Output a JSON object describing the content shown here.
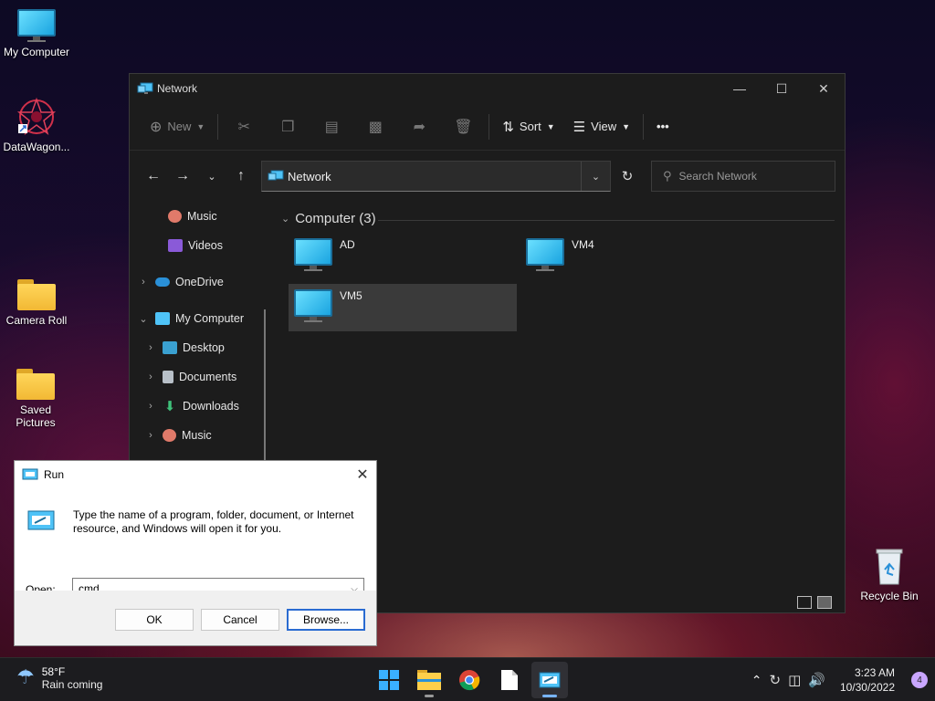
{
  "desktop": {
    "icons": [
      {
        "label": "My Computer"
      },
      {
        "label": "DataWagon..."
      },
      {
        "label": "Camera Roll"
      },
      {
        "label": "Saved Pictures"
      },
      {
        "label": "Recycle Bin"
      }
    ]
  },
  "explorer": {
    "title": "Network",
    "toolbar": {
      "new_label": "New",
      "sort_label": "Sort",
      "view_label": "View",
      "more_label": "•••"
    },
    "address": {
      "path": "Network"
    },
    "search": {
      "placeholder": "Search Network"
    },
    "nav": [
      {
        "label": "Music"
      },
      {
        "label": "Videos"
      },
      {
        "label": "OneDrive"
      },
      {
        "label": "My Computer"
      },
      {
        "label": "Desktop"
      },
      {
        "label": "Documents"
      },
      {
        "label": "Downloads"
      },
      {
        "label": "Music"
      }
    ],
    "group": {
      "label": "Computer (3)"
    },
    "items": [
      {
        "label": "AD"
      },
      {
        "label": "VM4"
      },
      {
        "label": "VM5"
      }
    ]
  },
  "run": {
    "title": "Run",
    "description": "Type the name of a program, folder, document, or Internet resource, and Windows will open it for you.",
    "open_label": "Open:",
    "value": "cmd",
    "ok_label": "OK",
    "cancel_label": "Cancel",
    "browse_label": "Browse..."
  },
  "taskbar": {
    "weather_temp": "58°F",
    "weather_desc": "Rain coming",
    "time": "3:23 AM",
    "date": "10/30/2022",
    "notification_count": "4"
  }
}
